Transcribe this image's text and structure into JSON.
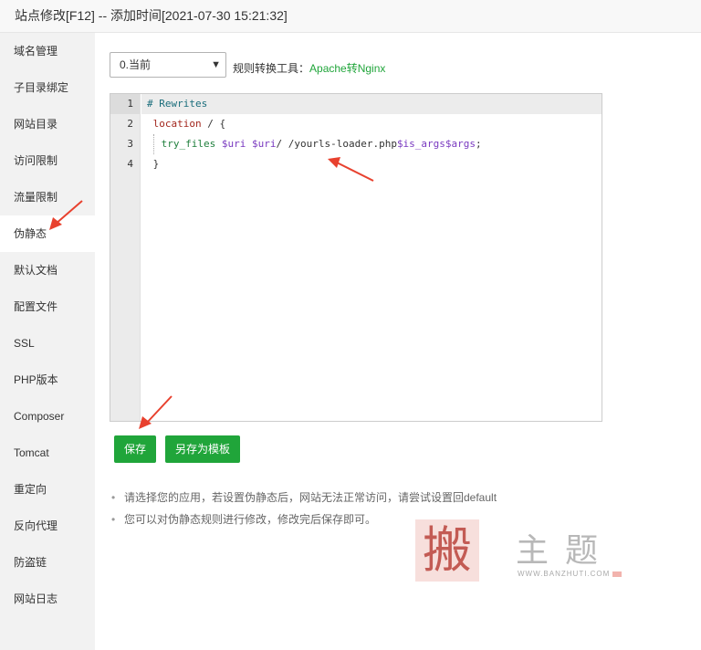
{
  "window": {
    "title": "站点修改[F12] -- 添加时间[2021-07-30 15:21:32]"
  },
  "sidebar": {
    "items": [
      {
        "label": "域名管理"
      },
      {
        "label": "子目录绑定"
      },
      {
        "label": "网站目录"
      },
      {
        "label": "访问限制"
      },
      {
        "label": "流量限制"
      },
      {
        "label": "伪静态",
        "active": true
      },
      {
        "label": "默认文档"
      },
      {
        "label": "配置文件"
      },
      {
        "label": "SSL"
      },
      {
        "label": "PHP版本"
      },
      {
        "label": "Composer"
      },
      {
        "label": "Tomcat"
      },
      {
        "label": "重定向"
      },
      {
        "label": "反向代理"
      },
      {
        "label": "防盗链"
      },
      {
        "label": "网站日志"
      }
    ]
  },
  "rewrite": {
    "select_value": "0.当前",
    "tool_label": "规则转换工具：",
    "tool_link": "Apache转Nginx"
  },
  "editor": {
    "line_numbers": [
      "1",
      "2",
      "3",
      "4"
    ],
    "line1": "# Rewrites",
    "line2_kw": "location",
    "line2_rest": " / {",
    "line3_fn": "try_files",
    "line3_var1": "$uri",
    "line3_var2": "$uri",
    "line3_path": "/ /yourls-loader.php",
    "line3_var3": "$is_args$args",
    "line3_end": ";",
    "line4": "}"
  },
  "buttons": {
    "save": "保存",
    "save_template": "另存为模板"
  },
  "tips": [
    "请选择您的应用，若设置伪静态后，网站无法正常访问，请尝试设置回default",
    "您可以对伪静态规则进行修改，修改完后保存即可。"
  ],
  "watermark": {
    "logo_char": "搬",
    "text": "主题",
    "url": "WWW.BANZHUTI.COM"
  },
  "colors": {
    "accent": "#20a53a",
    "arrow": "#e8412e"
  }
}
